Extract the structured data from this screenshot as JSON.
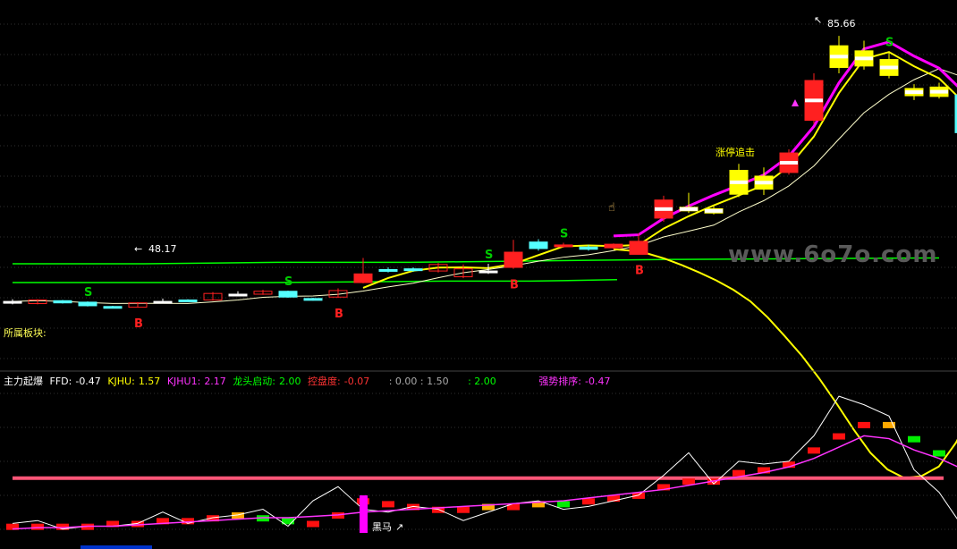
{
  "indicator_bar": {
    "name": "主力起爆",
    "ffd_label": "FFD:",
    "ffd_value": "-0.47",
    "kjhu_label": "KJHU:",
    "kjhu_value": "1.57",
    "kjhu1_label": "KJHU1:",
    "kjhu1_value": "2.17",
    "ltqd_label": "龙头启动:",
    "ltqd_value": "2.00",
    "kpd_label": "控盘度:",
    "kpd_value": "-0.07",
    "pair1": ": 0.00 : 1.50",
    "pair2": ": 2.00",
    "qspx_label": "强势排序:",
    "qspx_value": "-0.47",
    "colors": {
      "name": "#ffffff",
      "ffd": "#ffffff",
      "kjhu": "#ffff00",
      "kjhu1": "#ff33ff",
      "ltqd": "#00ff00",
      "kpd": "#ff3333",
      "pair1": "#aaaaaa",
      "pair2": "#00ff00",
      "qspx": "#ff33ff"
    }
  },
  "sector_label": "所属板块:",
  "watermark": "www.6o7o.com",
  "annotations": {
    "low_price": "48.17",
    "high_price": "85.66",
    "buy_marker": "B",
    "sell_marker": "S",
    "limit_chase": "涨停追击",
    "dark_horse": "黑马"
  },
  "colors": {
    "up": "#ff2020",
    "down": "#54ffff",
    "yellow_candle": "#ffff00",
    "ma_green": "#00ff00",
    "ma_yellow": "#ffff00",
    "ma_magenta": "#ff00ff",
    "grid": "#303030",
    "baseline_pink": "#ff5577"
  },
  "chart_data": {
    "type": "candlestick",
    "candles": [
      {
        "o": 48.9,
        "c": 49.0,
        "h": 49.3,
        "l": 48.6,
        "t": "flat"
      },
      {
        "o": 48.7,
        "c": 49.2,
        "h": 49.3,
        "l": 48.6,
        "t": "up"
      },
      {
        "o": 49.1,
        "c": 48.8,
        "h": 49.2,
        "l": 48.7,
        "t": "down"
      },
      {
        "o": 48.9,
        "c": 48.4,
        "h": 49.0,
        "l": 48.3,
        "t": "down"
      },
      {
        "o": 48.3,
        "c": 48.2,
        "h": 48.4,
        "l": 48.17,
        "t": "down"
      },
      {
        "o": 48.2,
        "c": 48.8,
        "h": 48.9,
        "l": 48.17,
        "t": "up"
      },
      {
        "o": 49.0,
        "c": 49.0,
        "h": 49.4,
        "l": 48.9,
        "t": "flat"
      },
      {
        "o": 49.2,
        "c": 49.1,
        "h": 49.3,
        "l": 49.0,
        "t": "down"
      },
      {
        "o": 49.2,
        "c": 50.1,
        "h": 50.3,
        "l": 49.1,
        "t": "up"
      },
      {
        "o": 50.0,
        "c": 50.0,
        "h": 50.4,
        "l": 49.7,
        "t": "flat"
      },
      {
        "o": 50.0,
        "c": 50.4,
        "h": 50.6,
        "l": 49.9,
        "t": "up"
      },
      {
        "o": 50.4,
        "c": 49.6,
        "h": 50.5,
        "l": 49.5,
        "t": "down"
      },
      {
        "o": 49.4,
        "c": 49.3,
        "h": 49.5,
        "l": 49.1,
        "t": "down"
      },
      {
        "o": 49.6,
        "c": 50.5,
        "h": 50.8,
        "l": 49.5,
        "t": "up"
      },
      {
        "o": 51.6,
        "c": 52.8,
        "h": 55.0,
        "l": 51.5,
        "t": "up"
      },
      {
        "o": 53.2,
        "c": 53.4,
        "h": 53.7,
        "l": 53.0,
        "t": "down"
      },
      {
        "o": 53.3,
        "c": 53.5,
        "h": 53.7,
        "l": 53.1,
        "t": "down"
      },
      {
        "o": 53.2,
        "c": 54.1,
        "h": 54.3,
        "l": 53.0,
        "t": "up"
      },
      {
        "o": 52.4,
        "c": 53.5,
        "h": 54.1,
        "l": 52.2,
        "t": "up"
      },
      {
        "o": 53.0,
        "c": 53.2,
        "h": 54.2,
        "l": 52.8,
        "t": "flat"
      },
      {
        "o": 53.7,
        "c": 55.8,
        "h": 57.5,
        "l": 53.5,
        "t": "up"
      },
      {
        "o": 56.3,
        "c": 57.2,
        "h": 57.6,
        "l": 56.0,
        "t": "down"
      },
      {
        "o": 56.6,
        "c": 56.8,
        "h": 57.1,
        "l": 56.4,
        "t": "up"
      },
      {
        "o": 56.5,
        "c": 56.2,
        "h": 56.8,
        "l": 56.0,
        "t": "down"
      },
      {
        "o": 56.4,
        "c": 56.9,
        "h": 57.0,
        "l": 56.2,
        "t": "up"
      },
      {
        "o": 55.5,
        "c": 57.3,
        "h": 58.4,
        "l": 55.5,
        "t": "up"
      },
      {
        "o": 60.5,
        "c": 63.0,
        "h": 63.6,
        "l": 60.0,
        "t": "up"
      },
      {
        "o": 61.5,
        "c": 62.0,
        "h": 64.0,
        "l": 61.2,
        "t": "yellow"
      },
      {
        "o": 61.2,
        "c": 61.8,
        "h": 62.2,
        "l": 61.0,
        "t": "yellow"
      },
      {
        "o": 63.8,
        "c": 67.1,
        "h": 68.0,
        "l": 63.4,
        "t": "yellow"
      },
      {
        "o": 64.5,
        "c": 66.3,
        "h": 67.5,
        "l": 63.7,
        "t": "yellow"
      },
      {
        "o": 66.8,
        "c": 69.5,
        "h": 70.0,
        "l": 66.5,
        "t": "up"
      },
      {
        "o": 74.0,
        "c": 79.5,
        "h": 80.5,
        "l": 73.5,
        "t": "up"
      },
      {
        "o": 81.3,
        "c": 84.3,
        "h": 85.66,
        "l": 80.5,
        "t": "yellow"
      },
      {
        "o": 81.5,
        "c": 83.6,
        "h": 85.0,
        "l": 81.0,
        "t": "yellow"
      },
      {
        "o": 80.2,
        "c": 82.4,
        "h": 83.5,
        "l": 79.8,
        "t": "yellow"
      },
      {
        "o": 77.4,
        "c": 78.4,
        "h": 79.0,
        "l": 76.8,
        "t": "yellow"
      },
      {
        "o": 77.3,
        "c": 78.6,
        "h": 79.2,
        "l": 77.0,
        "t": "yellow"
      },
      {
        "o": 77.5,
        "c": 72.3,
        "h": 77.6,
        "l": 70.5,
        "t": "down"
      }
    ],
    "ma_green_flat": [
      54.2,
      54.2,
      54.4,
      54.4,
      54.6,
      54.8,
      54.9,
      55.0
    ],
    "ma_green_low": [
      51.6,
      51.6,
      51.6,
      51.6,
      51.7,
      51.8,
      51.8,
      52.0
    ],
    "buy_signals": [
      5,
      13,
      20,
      25
    ],
    "sell_signals": [
      3,
      11,
      19,
      22,
      35
    ],
    "price_ylim": [
      40,
      90
    ],
    "indicator": {
      "bars": [
        0.2,
        0.2,
        0.2,
        0.2,
        0.3,
        0.3,
        0.4,
        0.4,
        0.5,
        0.6,
        0.5,
        0.4,
        0.3,
        0.6,
        1.1,
        1.0,
        0.9,
        0.8,
        0.8,
        0.9,
        0.9,
        1.0,
        1.0,
        1.1,
        1.2,
        1.3,
        1.6,
        1.8,
        1.8,
        2.1,
        2.2,
        2.4,
        2.9,
        3.4,
        3.8,
        3.8,
        3.3,
        2.8,
        2.1
      ],
      "bar_colors": [
        "r",
        "r",
        "r",
        "r",
        "r",
        "r",
        "r",
        "r",
        "r",
        "o",
        "g",
        "g",
        "r",
        "r",
        "r",
        "r",
        "r",
        "r",
        "r",
        "o",
        "r",
        "o",
        "g",
        "r",
        "r",
        "r",
        "r",
        "r",
        "r",
        "r",
        "r",
        "r",
        "r",
        "r",
        "r",
        "o",
        "g",
        "g",
        "g"
      ],
      "white_line": [
        0.4,
        0.5,
        0.2,
        0.3,
        0.3,
        0.4,
        0.8,
        0.4,
        0.6,
        0.7,
        0.9,
        0.3,
        1.2,
        1.7,
        0.9,
        0.8,
        1.0,
        0.9,
        0.5,
        0.8,
        1.1,
        1.2,
        0.9,
        1.0,
        1.2,
        1.4,
        2.1,
        2.9,
        1.8,
        2.6,
        2.5,
        2.6,
        3.5,
        4.9,
        4.6,
        4.2,
        2.3,
        1.5,
        0.2
      ],
      "magenta_line": [
        0.2,
        0.25,
        0.25,
        0.3,
        0.3,
        0.35,
        0.4,
        0.45,
        0.5,
        0.55,
        0.6,
        0.6,
        0.65,
        0.7,
        0.8,
        0.85,
        0.9,
        0.95,
        1.0,
        1.05,
        1.1,
        1.15,
        1.2,
        1.3,
        1.4,
        1.5,
        1.6,
        1.75,
        1.9,
        2.05,
        2.2,
        2.4,
        2.7,
        3.1,
        3.5,
        3.4,
        3.0,
        2.7,
        2.3
      ],
      "baseline": 2.0,
      "ylim": [
        0,
        5.0
      ]
    }
  }
}
